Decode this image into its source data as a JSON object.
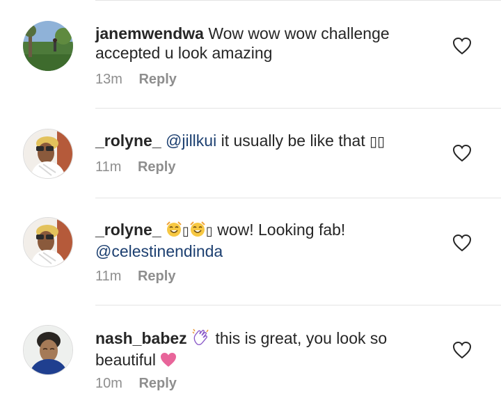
{
  "comments": [
    {
      "username": "janemwendwa",
      "text_lines": [
        "Wow wow wow challenge",
        "accepted u look amazing"
      ],
      "time": "13m",
      "reply_label": "Reply"
    },
    {
      "username": "_rolyne_",
      "mention": "@jillkui",
      "text": "it usually be like that",
      "trailing_glyphs": "▯▯",
      "time": "11m",
      "reply_label": "Reply"
    },
    {
      "username": "_rolyne_",
      "glyph": "▯",
      "text": "wow! Looking fab!",
      "mention": "@celestinendinda",
      "time": "11m",
      "reply_label": "Reply"
    },
    {
      "username": "nash_babez",
      "text_lines": [
        "this is great, you look so",
        "beautiful"
      ],
      "time": "10m",
      "reply_label": "Reply"
    }
  ],
  "icons": {
    "like": "heart-outline-icon",
    "clap": "clapping-hands-icon",
    "smile": "smiling-face-icon",
    "pink_heart": "pink-heart-icon"
  },
  "colors": {
    "mention": "#1c3f70",
    "meta": "#8e8e8e",
    "pink_heart": "#e8659a",
    "emoji_yellow": "#f7c843"
  }
}
